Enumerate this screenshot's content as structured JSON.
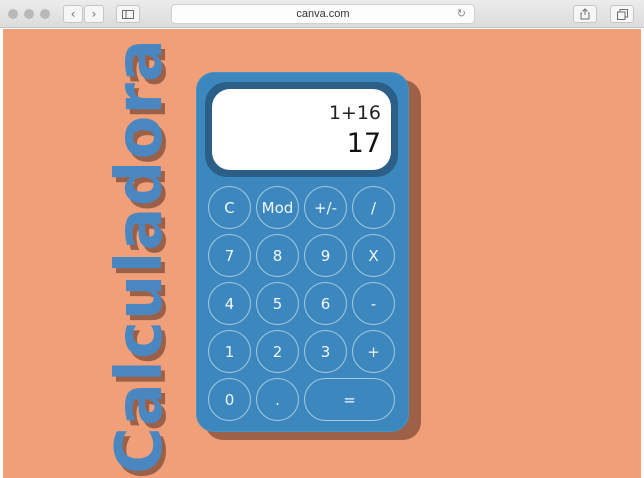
{
  "browser": {
    "url": "canva.com",
    "back_icon": "chevron-left-icon",
    "forward_icon": "chevron-right-icon",
    "sidebar_icon": "sidebar-icon",
    "reload_icon": "reload-icon",
    "share_icon": "share-icon",
    "tabs_icon": "tabs-icon"
  },
  "page": {
    "title": "Calculadora",
    "background": "#f19f78",
    "accent": "#3c87bd",
    "shadow": "#9c6147"
  },
  "display": {
    "expression": "1+16",
    "result": "17"
  },
  "keys": {
    "clear": "C",
    "mod": "Mod",
    "sign": "+/-",
    "divide": "/",
    "seven": "7",
    "eight": "8",
    "nine": "9",
    "multiply": "X",
    "four": "4",
    "five": "5",
    "six": "6",
    "minus": "-",
    "one": "1",
    "two": "2",
    "three": "3",
    "plus": "+",
    "zero": "0",
    "dot": ".",
    "equals": "="
  }
}
